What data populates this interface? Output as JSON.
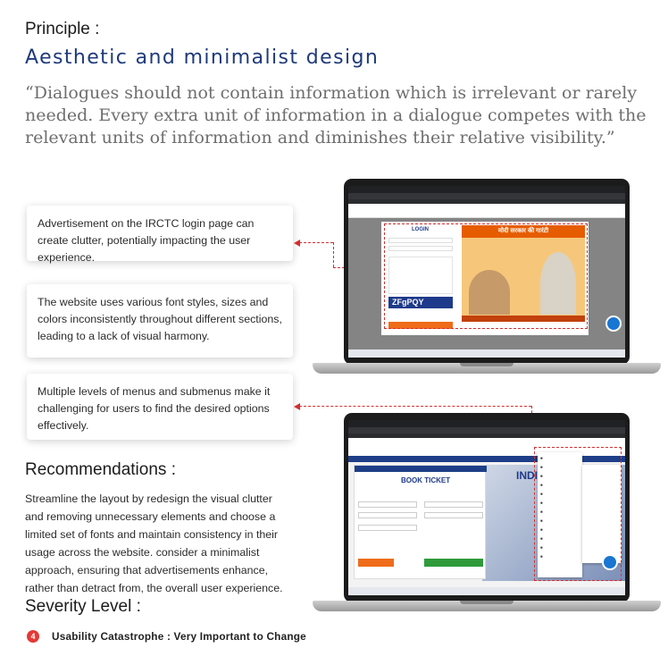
{
  "principle": {
    "label": "Principle :",
    "title": "Aesthetic and minimalist design",
    "quote": "“Dialogues should not contain information which is irrelevant or rarely needed. Every extra unit of information in a dialogue competes with the relevant units of information and diminishes their relative visibility.”"
  },
  "issues": [
    "Advertisement on the IRCTC login page can create clutter, potentially impacting the user experience.",
    "The website uses various font styles, sizes and colors inconsistently throughout different sections, leading to a lack of visual harmony.",
    "Multiple levels of menus and submenus make it challenging for users to find the desired options effectively."
  ],
  "recommendations": {
    "title": "Recommendations :",
    "body": "Streamline the layout by redesign the visual clutter and removing unnecessary  elements and choose a limited set of fonts and maintain consistency in their usage across the website. consider a minimalist approach, ensuring that advertisements enhance, rather than detract from, the overall user experience."
  },
  "severity": {
    "title": "Severity Level :",
    "level": "4",
    "text": "Usability Catastrophe : Very Important to Change"
  },
  "screenshot1": {
    "login_title": "LOGIN",
    "captcha": "ZFgPQY",
    "ad_headline": "मोदी सरकार की गारंटी"
  },
  "screenshot2": {
    "book_ticket": "BOOK TICKET",
    "india": "INDIA"
  },
  "colors": {
    "accent_title": "#1f3a7a",
    "connector": "#d32f2f",
    "severity_badge": "#e53935"
  }
}
